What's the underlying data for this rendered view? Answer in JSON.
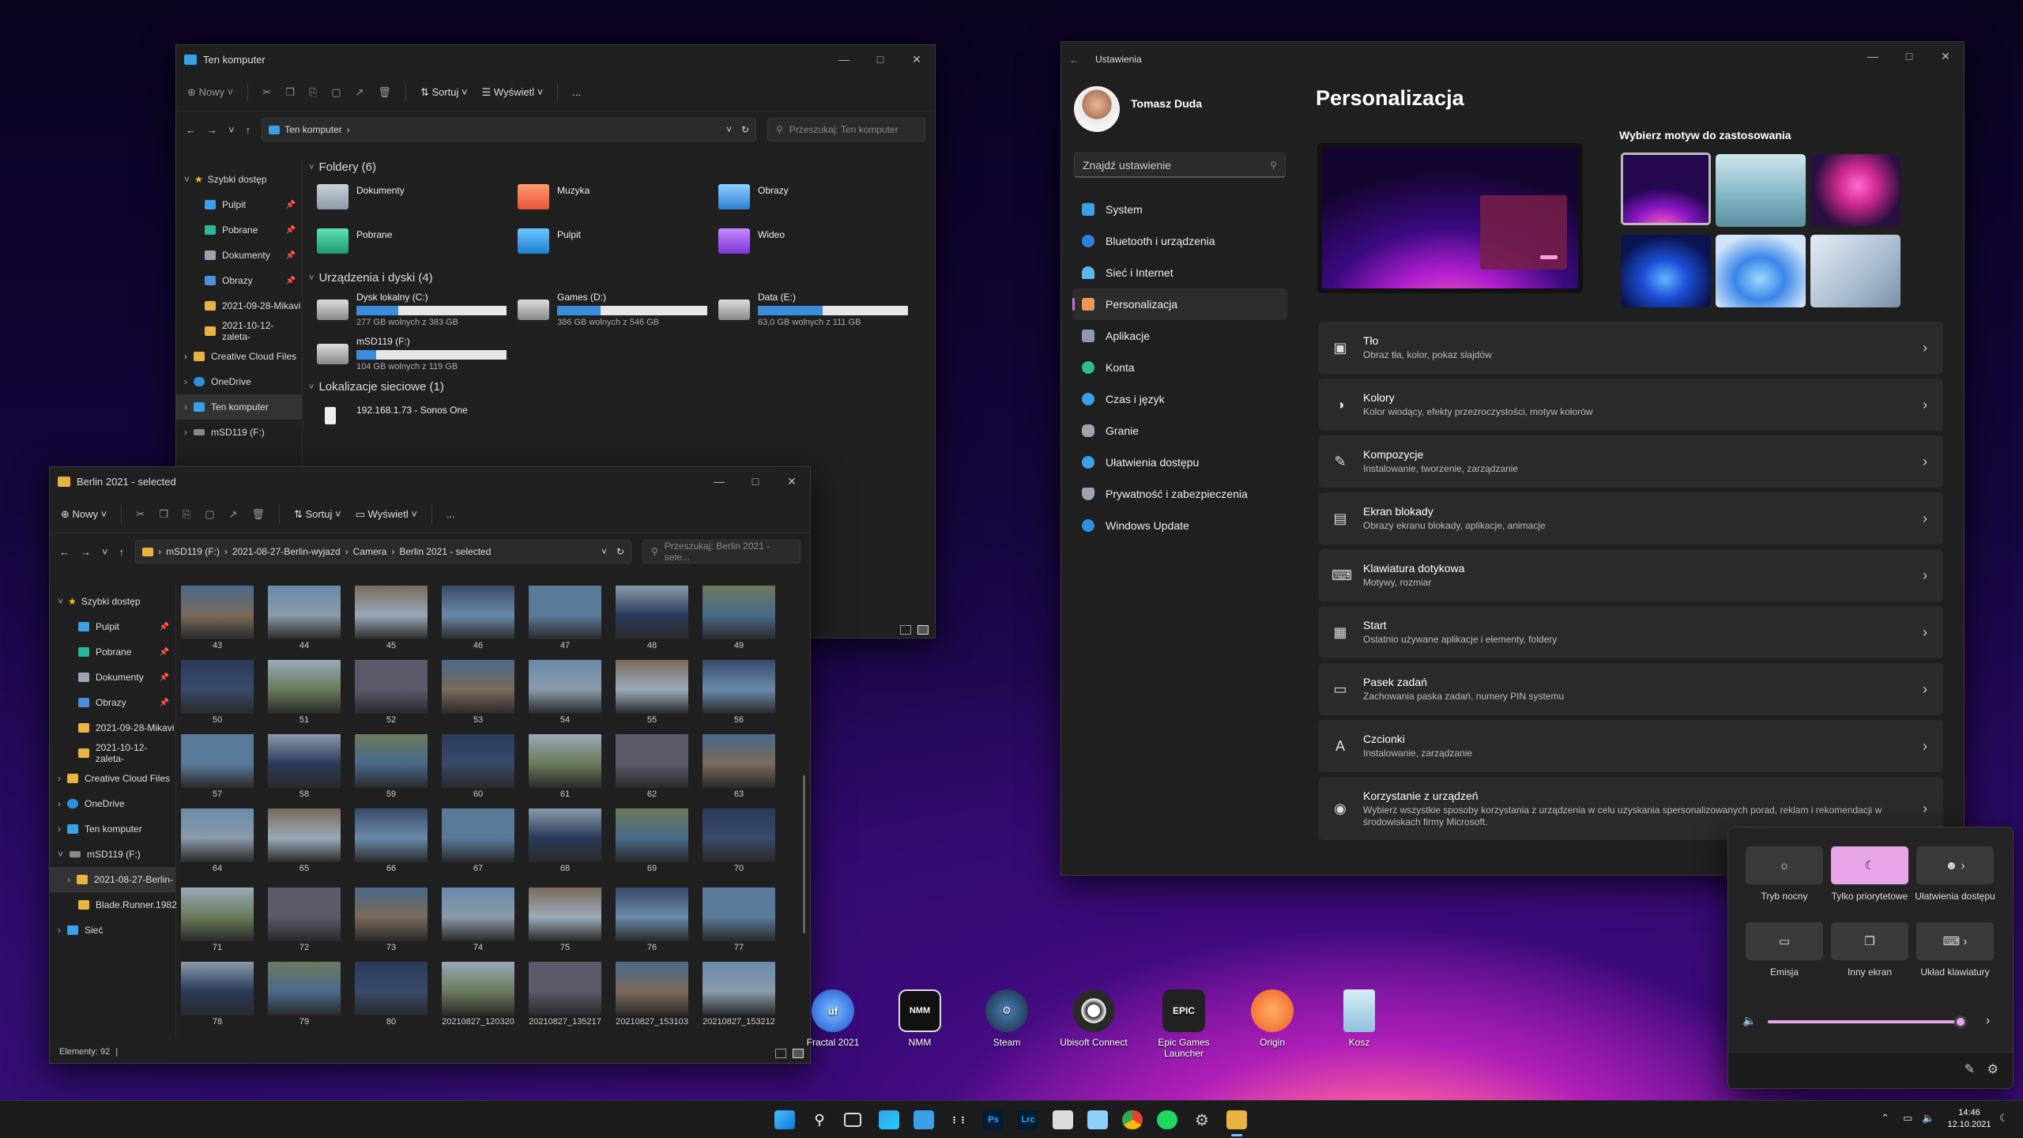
{
  "explorer1": {
    "title": "Ten komputer",
    "cmd": {
      "new": "Nowy",
      "sort": "Sortuj",
      "view": "Wyświetl",
      "more": "..."
    },
    "address": "Ten komputer",
    "search_placeholder": "Przeszukaj: Ten komputer",
    "nav": [
      {
        "label": "Szybki dostęp"
      },
      {
        "label": "Pulpit"
      },
      {
        "label": "Pobrane"
      },
      {
        "label": "Dokumenty"
      },
      {
        "label": "Obrazy"
      },
      {
        "label": "2021-09-28-Mikavi"
      },
      {
        "label": "2021-10-12-zaleta-"
      },
      {
        "label": "Creative Cloud Files"
      },
      {
        "label": "OneDrive"
      },
      {
        "label": "Ten komputer"
      },
      {
        "label": "mSD119 (F:)"
      }
    ],
    "folders_header": "Foldery (6)",
    "folders": [
      "Dokumenty",
      "Muzyka",
      "Obrazy",
      "Pobrane",
      "Pulpit",
      "Wideo"
    ],
    "drives_header": "Urządzenia i dyski (4)",
    "drives": [
      {
        "name": "Dysk lokalny (C:)",
        "free": "277 GB wolnych z 383 GB",
        "used_fraction": 0.28
      },
      {
        "name": "Games (D:)",
        "free": "386 GB wolnych z 546 GB",
        "used_fraction": 0.29
      },
      {
        "name": "Data (E:)",
        "free": "63,0 GB wolnych z 111 GB",
        "used_fraction": 0.43
      },
      {
        "name": "mSD119 (F:)",
        "free": "104 GB wolnych z 119 GB",
        "used_fraction": 0.13
      }
    ],
    "network_header": "Lokalizacje sieciowe (1)",
    "network": [
      "192.168.1.73 - Sonos One"
    ]
  },
  "explorer2": {
    "title": "Berlin 2021 - selected",
    "cmd": {
      "new": "Nowy",
      "sort": "Sortuj",
      "view": "Wyświetl",
      "more": "..."
    },
    "crumbs": [
      "mSD119 (F:)",
      "2021-08-27-Berlin-wyjazd",
      "Camera",
      "Berlin 2021 - selected"
    ],
    "search_placeholder": "Przeszukaj: Berlin 2021 - sele...",
    "nav": [
      {
        "label": "Szybki dostęp"
      },
      {
        "label": "Pulpit"
      },
      {
        "label": "Pobrane"
      },
      {
        "label": "Dokumenty"
      },
      {
        "label": "Obrazy"
      },
      {
        "label": "2021-09-28-Mikavi"
      },
      {
        "label": "2021-10-12-zaleta-"
      },
      {
        "label": "Creative Cloud Files"
      },
      {
        "label": "OneDrive"
      },
      {
        "label": "Ten komputer"
      },
      {
        "label": "mSD119 (F:)"
      },
      {
        "label": "2021-08-27-Berlin-"
      },
      {
        "label": "Blade.Runner.1982"
      },
      {
        "label": "Sieć"
      }
    ],
    "thumbs": [
      "43",
      "44",
      "45",
      "46",
      "47",
      "48",
      "49",
      "50",
      "51",
      "52",
      "53",
      "54",
      "55",
      "56",
      "57",
      "58",
      "59",
      "60",
      "61",
      "62",
      "63",
      "64",
      "65",
      "66",
      "67",
      "68",
      "69",
      "70",
      "71",
      "72",
      "73",
      "74",
      "75",
      "76",
      "77",
      "78",
      "79",
      "80",
      "20210827_120320",
      "20210827_135217",
      "20210827_153103",
      "20210827_153212"
    ],
    "status": "Elementy: 92"
  },
  "settings": {
    "title": "Ustawienia",
    "user": "Tomasz Duda",
    "search_placeholder": "Znajdź ustawienie",
    "nav": [
      "System",
      "Bluetooth i urządzenia",
      "Sieć i Internet",
      "Personalizacja",
      "Aplikacje",
      "Konta",
      "Czas i język",
      "Granie",
      "Ułatwienia dostępu",
      "Prywatność i zabezpieczenia",
      "Windows Update"
    ],
    "page_title": "Personalizacja",
    "themes_header": "Wybierz motyw do zastosowania",
    "cards": [
      {
        "title": "Tło",
        "sub": "Obraz tła, kolor, pokaz slajdów"
      },
      {
        "title": "Kolory",
        "sub": "Kolor wiodący, efekty przezroczystości, motyw kolorów"
      },
      {
        "title": "Kompozycje",
        "sub": "Instalowanie, tworzenie, zarządzanie"
      },
      {
        "title": "Ekran blokady",
        "sub": "Obrazy ekranu blokady, aplikacje, animacje"
      },
      {
        "title": "Klawiatura dotykowa",
        "sub": "Motywy, rozmiar"
      },
      {
        "title": "Start",
        "sub": "Ostatnio używane aplikacje i elementy, foldery"
      },
      {
        "title": "Pasek zadań",
        "sub": "Zachowania paska zadań, numery PIN systemu"
      },
      {
        "title": "Czcionki",
        "sub": "Instalowanie, zarządzanie"
      },
      {
        "title": "Korzystanie z urządzeń",
        "sub": "Wybierz wszystkie sposoby korzystania z urządzenia w celu uzyskania spersonalizowanych porad, reklam i rekomendacji w środowiskach firmy Microsoft."
      }
    ]
  },
  "quick_settings": {
    "buttons": [
      "Tryb nocny",
      "Tylko priorytetowe",
      "Ułatwienia dostępu",
      "Emisja",
      "Inny ekran",
      "Układ klawiatury"
    ],
    "volume_fraction": 0.97
  },
  "desktop_icons": [
    "Fractal 2021",
    "NMM",
    "Steam",
    "Ubisoft Connect",
    "Epic Games Launcher",
    "Origin",
    "Kosz"
  ],
  "tray": {
    "time": "14:46",
    "date": "12.10.2021"
  }
}
